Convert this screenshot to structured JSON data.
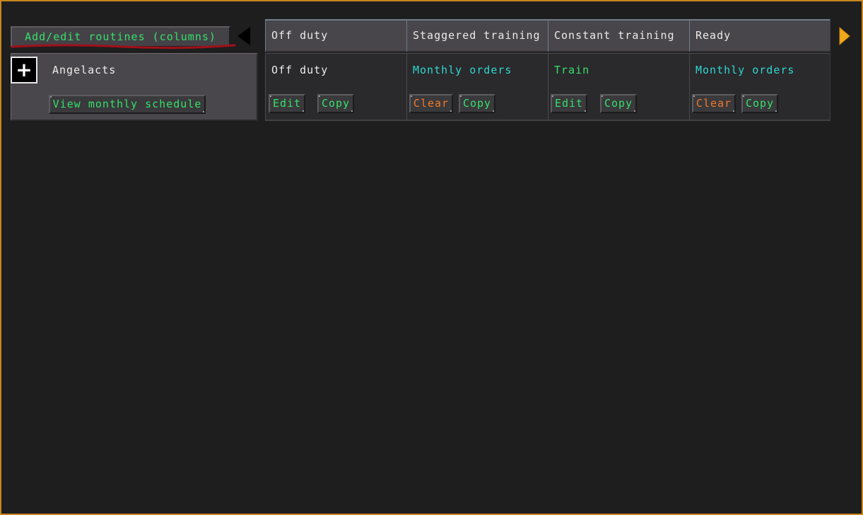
{
  "toolbar": {
    "add_edit_label": "Add/edit routines (columns)"
  },
  "squad": {
    "name": "Angelacts",
    "view_schedule_label": "View monthly schedule",
    "plus_symbol": "+"
  },
  "columns": [
    {
      "header": "Off duty",
      "routine": "Off duty",
      "routine_color": "#ececec",
      "btn1": "Edit",
      "btn1_color": "#35e06a",
      "btn2": "Copy"
    },
    {
      "header": "Staggered training",
      "routine": "Monthly orders",
      "routine_color": "#2ed8d0",
      "btn1": "Clear",
      "btn1_color": "#f07a2a",
      "btn2": "Copy"
    },
    {
      "header": "Constant training",
      "routine": "Train",
      "routine_color": "#35e06a",
      "btn1": "Edit",
      "btn1_color": "#35e06a",
      "btn2": "Copy"
    },
    {
      "header": "Ready",
      "routine": "Monthly orders",
      "routine_color": "#2ed8d0",
      "btn1": "Clear",
      "btn1_color": "#f07a2a",
      "btn2": "Copy"
    }
  ],
  "colors": {
    "frame_border": "#c9861c",
    "accent_green": "#35e06a",
    "accent_cyan": "#2ed8d0",
    "accent_orange": "#f07a2a",
    "annotation_red": "#a0101a",
    "arrow_right": "#f0a818"
  },
  "icons": {
    "scroll_left": "left-triangle-icon",
    "scroll_right": "right-triangle-icon",
    "add_squad": "plus-icon"
  }
}
